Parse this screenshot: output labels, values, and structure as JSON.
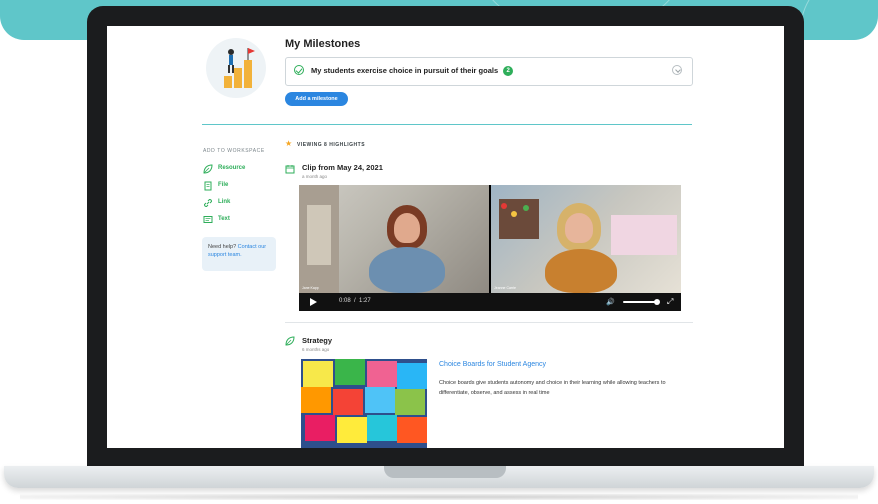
{
  "milestones": {
    "title": "My Milestones",
    "item_text": "My students exercise choice in pursuit of their goals",
    "item_count": "2",
    "add_button": "Add a milestone"
  },
  "workspace": {
    "header": "ADD TO WORKSPACE",
    "items": [
      {
        "label": "Resource",
        "icon": "leaf-icon"
      },
      {
        "label": "File",
        "icon": "file-icon"
      },
      {
        "label": "Link",
        "icon": "link-icon"
      },
      {
        "label": "Text",
        "icon": "text-icon"
      }
    ],
    "help_text": "Need help?",
    "help_link": "Contact our support team."
  },
  "highlights": {
    "viewing_label": "VIEWING 8 HIGHLIGHTS",
    "clip": {
      "title": "Clip from May 24, 2021",
      "time": "a month ago",
      "current_time": "0:08",
      "separator": "/",
      "duration": "1:27",
      "volume": 0.85
    },
    "strategy": {
      "title": "Strategy",
      "time": "6 months ago",
      "resource_title": "Choice Boards for Student Agency",
      "resource_desc": "Choice boards give students autonomy and choice in their learning while allowing teachers to differentiate, observe, and assess in real time"
    }
  },
  "colors": {
    "accent_green": "#2eae5a",
    "accent_blue": "#2b86e0",
    "teal": "#5fc6c9"
  }
}
